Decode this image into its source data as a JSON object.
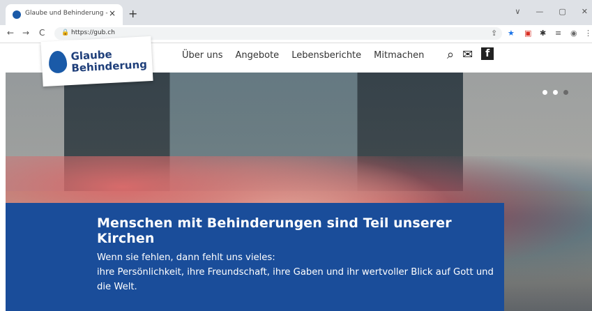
{
  "browser": {
    "tab_title": "Glaube und Behinderung -",
    "tab_close": "×",
    "new_tab": "+",
    "url": "https://gub.ch",
    "window_controls": [
      "∨",
      "—",
      "▢",
      "✕"
    ],
    "nav": {
      "back": "←",
      "forward": "→",
      "reload": "C"
    },
    "omnibox_lock": "🔒",
    "extensions": [
      {
        "name": "share-icon",
        "glyph": "⇪"
      },
      {
        "name": "star-icon",
        "glyph": "★"
      },
      {
        "name": "extension-red-icon",
        "glyph": "▣"
      },
      {
        "name": "puzzle-icon",
        "glyph": "✱"
      },
      {
        "name": "playlist-icon",
        "glyph": "≡"
      },
      {
        "name": "profile-icon",
        "glyph": "◉"
      },
      {
        "name": "menu-icon",
        "glyph": "⋮"
      }
    ]
  },
  "site": {
    "logo": {
      "line1": "Glaube",
      "line2": "Behinderung"
    },
    "menu": [
      "Über uns",
      "Angebote",
      "Lebensberichte",
      "Mitmachen"
    ],
    "icons": [
      "search-icon",
      "mail-icon",
      "facebook-icon"
    ],
    "facebook_glyph": "f",
    "search_glyph": "⌕",
    "mail_glyph": "✉"
  },
  "hero": {
    "headline": "Menschen mit Behinderungen sind Teil unserer Kirchen",
    "line1": "Wenn sie fehlen, dann fehlt uns vieles:",
    "line2": "ihre Persönlichkeit, ihre Freundschaft, ihre Gaben und ihr wertvoller Blick auf Gott und die Welt.",
    "slides": 3,
    "active_slide": 3
  }
}
